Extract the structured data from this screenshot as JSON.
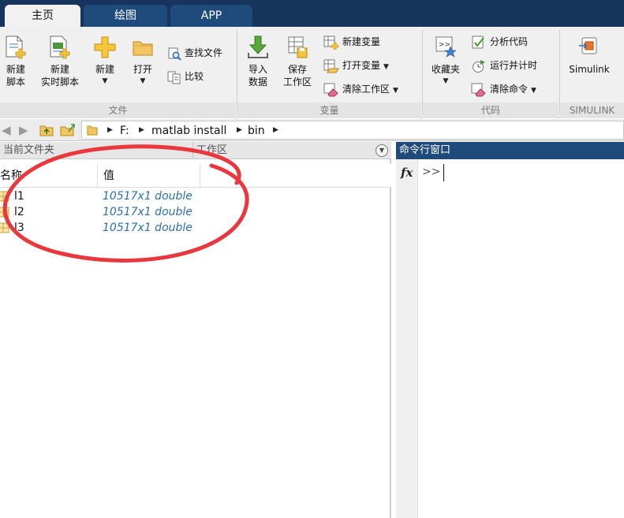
{
  "tabs": [
    {
      "label": "主页",
      "active": true
    },
    {
      "label": "绘图",
      "active": false
    },
    {
      "label": "APP",
      "active": false
    }
  ],
  "ribbon": {
    "file_group": {
      "label": "文件",
      "new_script": [
        "新建",
        "脚本"
      ],
      "new_live_script": [
        "新建",
        "实时脚本"
      ],
      "new": "新建",
      "open": "打开",
      "find_files": "查找文件",
      "compare": "比较"
    },
    "variable_group": {
      "label": "变量",
      "import_data": [
        "导入",
        "数据"
      ],
      "save_workspace": [
        "保存",
        "工作区"
      ],
      "new_variable": "新建变量",
      "open_variable": "打开变量",
      "clear_workspace": "清除工作区"
    },
    "code_group": {
      "label": "代码",
      "favorites": "收藏夹",
      "analyze_code": "分析代码",
      "run_and_time": "运行并计时",
      "clear_commands": "清除命令"
    },
    "simulink_group": {
      "label": "SIMULINK",
      "simulink": "Simulink"
    }
  },
  "address": {
    "crumbs": [
      "F:",
      "matlab install",
      "bin"
    ]
  },
  "current_folder": {
    "title": "当前文件夹"
  },
  "workspace": {
    "title": "工作区",
    "columns": {
      "name": "名称",
      "value": "值"
    },
    "variables": [
      {
        "name": "l1",
        "value": "10517x1 double"
      },
      {
        "name": "l2",
        "value": "10517x1 double"
      },
      {
        "name": "l3",
        "value": "10517x1 double"
      }
    ]
  },
  "command_window": {
    "title": "命令行窗口",
    "fx": "fx",
    "prompt": ">>"
  },
  "colors": {
    "tabbar": "#17355c",
    "active_tab": "#f1f1f1",
    "variable_value": "#2b6fb3",
    "annotation": "#e8383d"
  }
}
